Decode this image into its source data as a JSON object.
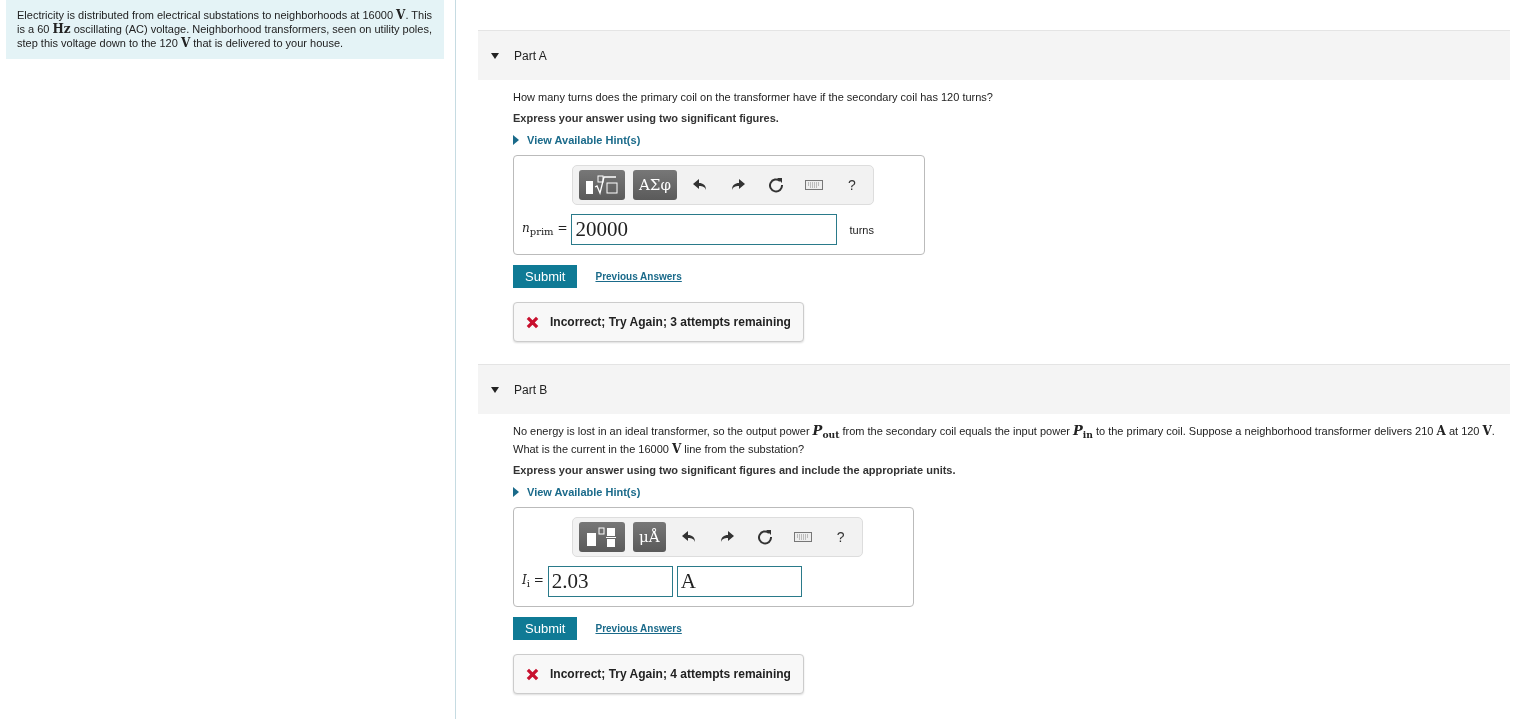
{
  "intro": "Electricity is distributed from electrical substations to neighborhoods at 16000 **V**. This is a 60 **Hz** oscillating (AC) voltage. Neighborhood transformers, seen on utility poles, step this voltage down to the 120 **V** that is delivered to your house.",
  "parts": [
    {
      "label": "Part A",
      "expanded": true,
      "question": "How many turns does the primary coil on the transformer have if the secondary coil has 120 turns?",
      "instruction": "Express your answer using two significant figures.",
      "hint_link": "View Available Hint(s)",
      "tools": [
        {
          "kind": "radical"
        },
        {
          "kind": "symbols",
          "label": "ΑΣφ"
        },
        {
          "kind": "undo"
        },
        {
          "kind": "redo"
        },
        {
          "kind": "reset"
        },
        {
          "kind": "keyboard"
        },
        {
          "kind": "help",
          "label": "?"
        }
      ],
      "variable": "*n*$_{prim}$ =",
      "value": "20000",
      "unit_label": "turns",
      "submit": "Submit",
      "previous_answers": "Previous Answers",
      "feedback": {
        "correct": false,
        "text": "Incorrect; Try Again; 3 attempts remaining"
      }
    },
    {
      "label": "Part B",
      "expanded": true,
      "question": "No energy is lost in an ideal transformer, so the output power *P*$_{out}$ from the secondary coil equals the input power *P*$_{in}$ to the primary coil. Suppose a neighborhood transformer delivers 210 **A** at 120 **V**. What is the current in the 16000 **V** line from the substation?",
      "instruction": "Express your answer using two significant figures and include the appropriate units.",
      "hint_link": "View Available Hint(s)",
      "tools": [
        {
          "kind": "fraction"
        },
        {
          "kind": "symbols",
          "label": "μÅ"
        },
        {
          "kind": "undo"
        },
        {
          "kind": "redo"
        },
        {
          "kind": "reset"
        },
        {
          "kind": "keyboard"
        },
        {
          "kind": "help",
          "label": "?"
        }
      ],
      "variable": "*I*$_{i}$ =",
      "value": "2.03",
      "units_value": "A",
      "submit": "Submit",
      "previous_answers": "Previous Answers",
      "feedback": {
        "correct": false,
        "text": "Incorrect; Try Again; 4 attempts remaining"
      }
    }
  ]
}
